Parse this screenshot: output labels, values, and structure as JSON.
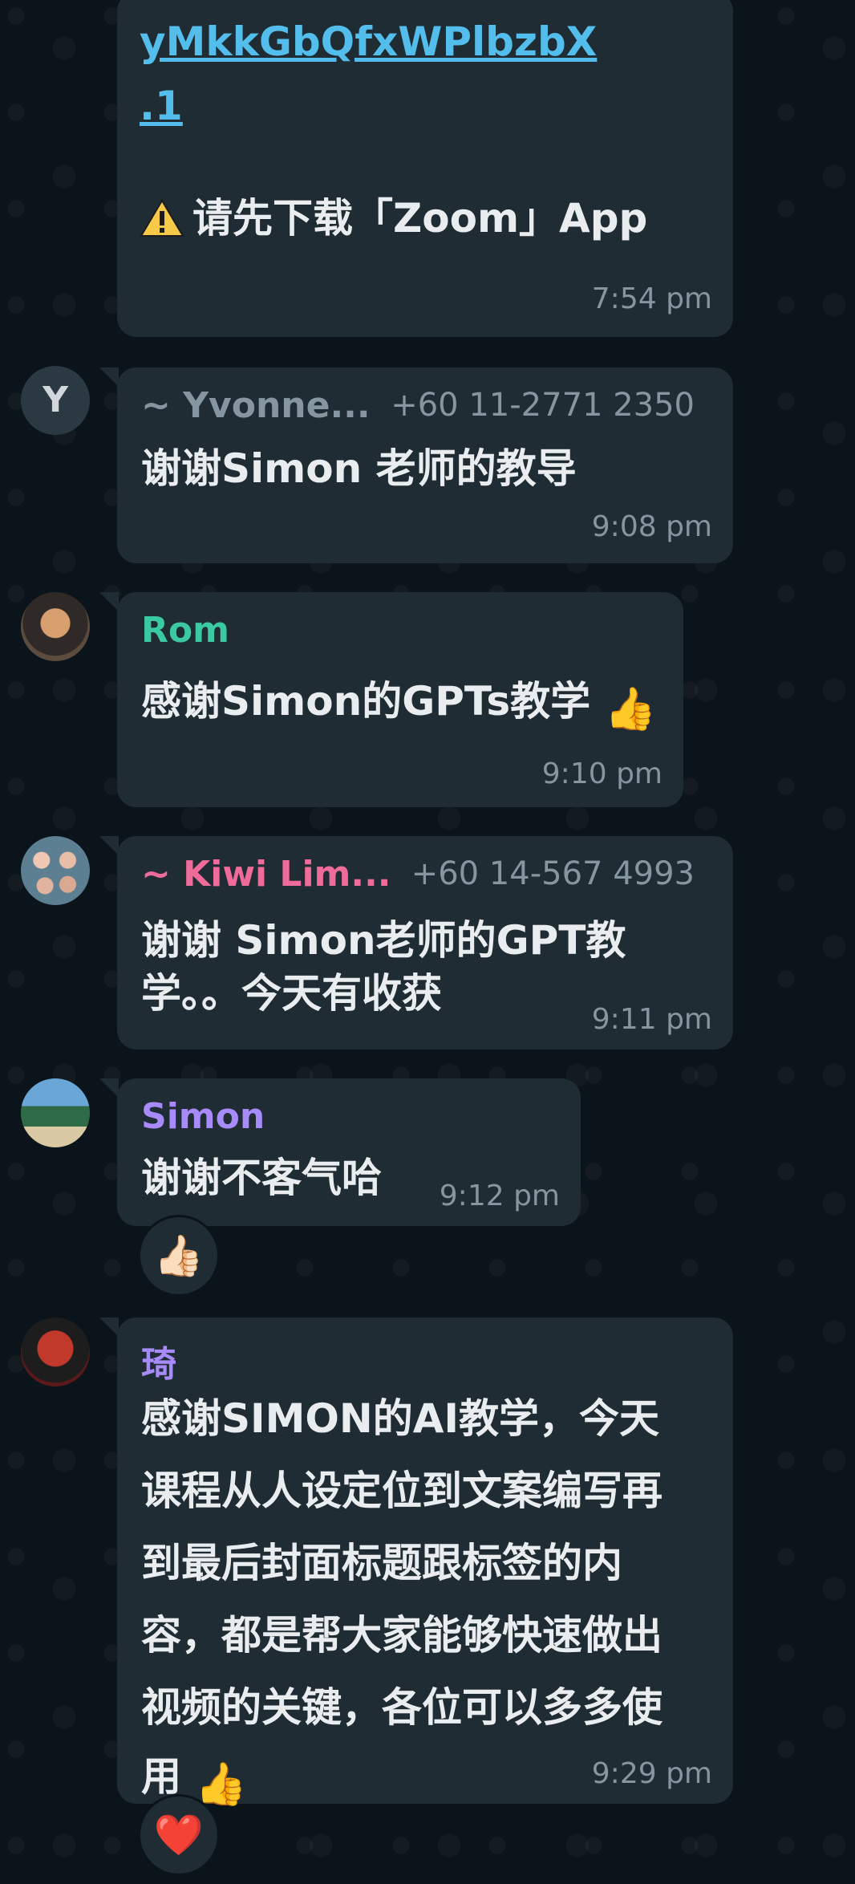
{
  "messages": [
    {
      "link_lines": [
        "yMkkGbQfxWPlbzbX",
        ".1"
      ],
      "warning": "请先下载「Zoom」App",
      "time": "7:54 pm"
    },
    {
      "avatar_letter": "Y",
      "sender": "~ Yvonne...",
      "phone": "+60 11-2771 2350",
      "text": "谢谢Simon 老师的教导",
      "time": "9:08 pm"
    },
    {
      "sender": "Rom",
      "text": "感谢Simon的GPTs教学",
      "emoji": "👍",
      "time": "9:10 pm"
    },
    {
      "sender": "~ Kiwi Lim...",
      "phone": "+60 14-567 4993",
      "lines": [
        "谢谢 Simon老师的GPT教",
        "学。。今天有收获"
      ],
      "time": "9:11 pm"
    },
    {
      "sender": "Simon",
      "text": "谢谢不客气哈",
      "time": "9:12 pm",
      "reaction": "👍🏻"
    },
    {
      "sender": "琦",
      "lines": [
        "感谢SIMON的AI教学，今天",
        "课程从人设定位到文案编写再",
        "到最后封面标题跟标签的内",
        "容，都是帮大家能够快速做出",
        "视频的关键，各位可以多多使",
        "用"
      ],
      "emoji": "👍",
      "time": "9:29 pm",
      "reaction": "❤️"
    }
  ],
  "colors": {
    "background": "#0b141a",
    "bubble": "#202c33",
    "link": "#53bdeb",
    "yvonne": "#8696a0",
    "rom": "#3bc9a1",
    "kiwi": "#ef6b9a",
    "simon": "#a78bfa",
    "qi": "#a78bfa",
    "meta": "#8696a0"
  }
}
